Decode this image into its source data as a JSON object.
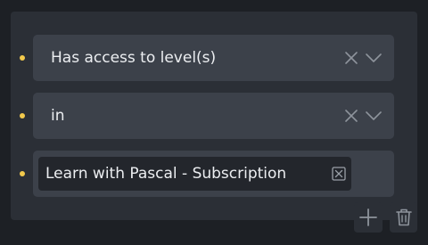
{
  "conditions": [
    {
      "value": "Has access to level(s)"
    },
    {
      "value": "in"
    }
  ],
  "selected_tags": [
    {
      "label": "Learn with Pascal - Subscription"
    }
  ],
  "colors": {
    "bullet": "#f2c94c",
    "panel": "#2b2f36",
    "field": "#3c414a",
    "tag": "#23262c"
  },
  "icons": {
    "clear": "close-icon",
    "dropdown": "chevron-down-icon",
    "tag_remove": "boxed-x-icon",
    "add": "plus-icon",
    "delete": "trash-icon"
  }
}
